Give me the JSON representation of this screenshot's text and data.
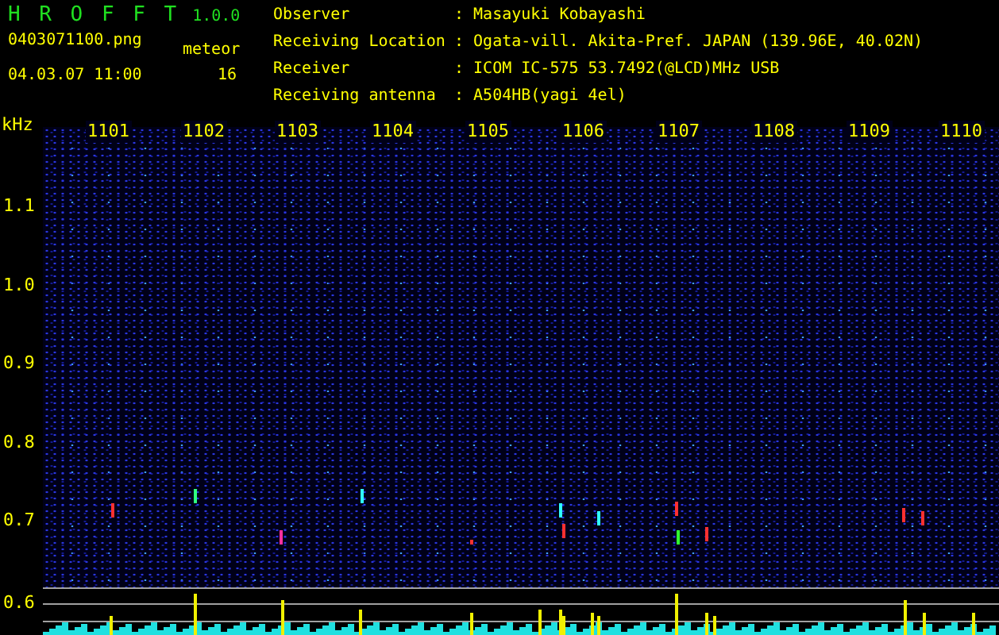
{
  "app": {
    "name": "H R O F F T",
    "version": "1.0.0"
  },
  "file": {
    "name": "0403071100.png",
    "datetime": "04.03.07 11:00",
    "meteor_label": "meteor",
    "meteor_count": "16"
  },
  "info": [
    {
      "label": "Observer",
      "value": ": Masayuki Kobayashi"
    },
    {
      "label": "Receiving Location",
      "value": ": Ogata-vill. Akita-Pref. JAPAN (139.96E, 40.02N)"
    },
    {
      "label": "Receiver",
      "value": ": ICOM IC-575 53.7492(@LCD)MHz USB"
    },
    {
      "label": "Receiving antenna",
      "value": ": A504HB(yagi 4el)"
    }
  ],
  "plot": {
    "unit": "kHz",
    "y_ticks": [
      "1.1",
      "1.0",
      "0.9",
      "0.8",
      "0.7",
      "0.6"
    ],
    "x_ticks": [
      "1101",
      "1102",
      "1103",
      "1104",
      "1105",
      "1106",
      "1107",
      "1108",
      "1109",
      "1110"
    ]
  }
}
